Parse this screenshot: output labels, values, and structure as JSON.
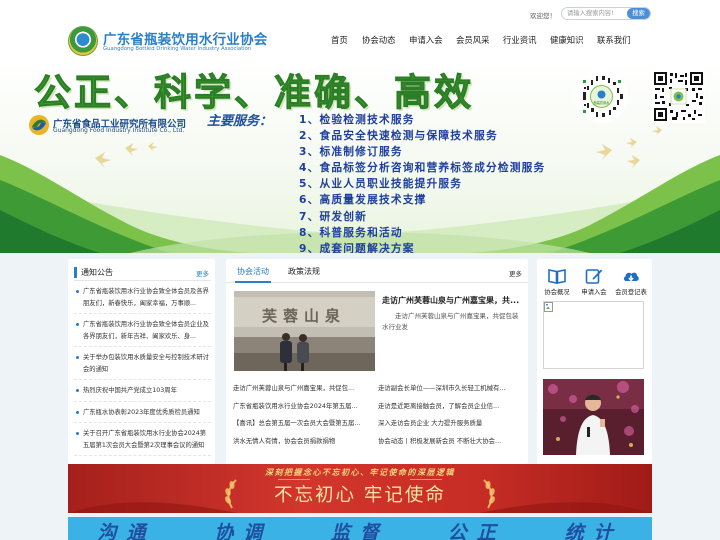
{
  "header": {
    "site_title": "广东省瓶装饮用水行业协会",
    "site_subtitle": "Guangdong Bottled Drinking Water Industry Association",
    "welcome": "欢迎您！",
    "search": {
      "placeholder": "请输入搜索内容!",
      "button": "搜索"
    },
    "nav": [
      "首页",
      "协会动态",
      "申请入会",
      "会员风采",
      "行业资讯",
      "健康知识",
      "联系我们"
    ]
  },
  "banner": {
    "slogan": "公正、科学、准确、高效",
    "institute_cn": "广东省食品工业研究所有限公司",
    "institute_en": "Guangdong Food Industry Institute Co., Ltd.",
    "services_title": "主要服务：",
    "services": [
      "1、检验检测技术服务",
      "2、食品安全快速检测与保障技术服务",
      "3、标准制修订服务",
      "4、食品标签分析咨询和营养标签成分检测服务",
      "5、从业人员职业技能提升服务",
      "6、高质量发展技术支撑",
      "7、研发创新",
      "8、科普服务和活动",
      "9、成套问题解决方案"
    ],
    "qr_badge": "瓶装饮用水"
  },
  "notice": {
    "title": "通知公告",
    "more": "更多",
    "items": [
      "广东省瓶装饮用水行业协会致全体会员及各界朋友们，新春快乐，阖家幸福，万事顺...",
      "广东省瓶装饮用水行业协会致全体会员企业及各界朋友们，新年吉祥、阖家欢乐、身...",
      "关于举办包装饮用水质量安全与控制技术研讨会的通知",
      "热烈庆祝中国共产党成立103周年",
      "广东瓶水协表彰2023年度优秀质检员通知",
      "关于召开广东省瓶装饮用水行业协会2024第五届第1次会员大会暨第2次理事会议的通知"
    ]
  },
  "news": {
    "tabs": [
      "协会活动",
      "政策法规"
    ],
    "more": "更多",
    "featured": {
      "image_text": "芙蓉山泉",
      "title": "走访广州芙蓉山泉与广州嘉宝果，共...",
      "summary": "走访广州芙蓉山泉与广州嘉宝果，共促包装水行业发"
    },
    "items": [
      "走访广州芙蓉山泉与广州嘉宝果，共促包...",
      "走访副会长单位——深圳市久长轻工机械有...",
      "广东省瓶装饮用水行业协会2024年第五届...",
      "走访是近距离接触会员，了解会员企业信...",
      "【喜讯】总会第五届一次会员大会暨第五届...",
      "深入走访会员企业 大力提升服务质量",
      "洪水无情人有情，协会会员捐款捐物",
      "协会动态丨积极发展新会员 不断壮大协会..."
    ]
  },
  "side": {
    "quick_links": [
      {
        "label": "协会概况",
        "icon": "book-icon"
      },
      {
        "label": "申请入会",
        "icon": "edit-icon"
      },
      {
        "label": "会员登记表",
        "icon": "cloud-download-icon"
      }
    ]
  },
  "red_banner": {
    "top_text": "深刻把握念心不忘初心、牢记使命的深层逻辑",
    "main_text": "不忘初心 牢记使命"
  },
  "blue_banner": {
    "words": [
      "沟通",
      "协调",
      "监督",
      "公正",
      "统计"
    ]
  },
  "colors": {
    "brand_blue": "#2a7fc8",
    "slogan_green": "#3fa034",
    "service_blue": "#1e3f9e",
    "party_red": "#c72d25"
  }
}
